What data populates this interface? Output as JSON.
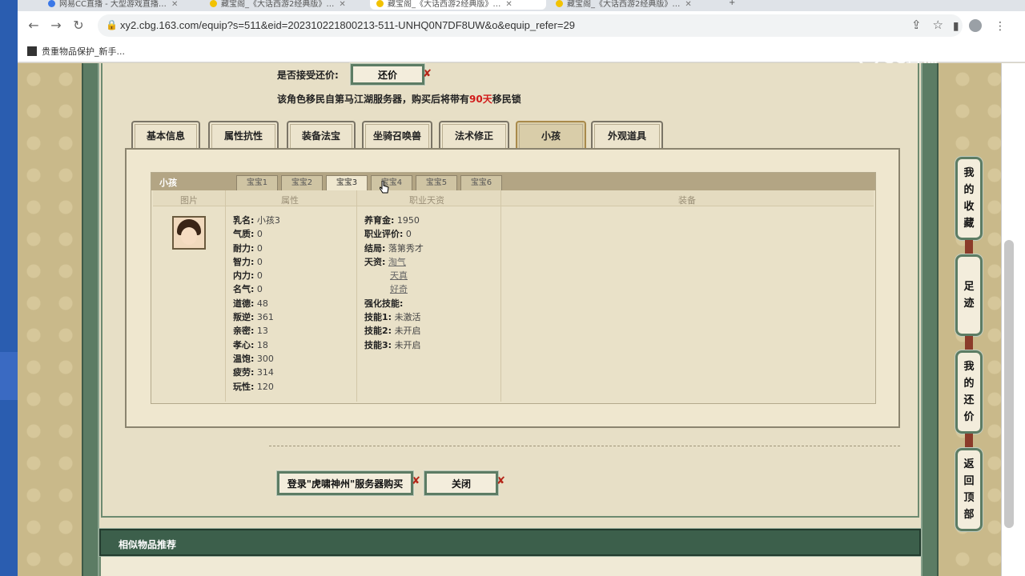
{
  "browser": {
    "tabs": [
      {
        "label": "网易CC直播 - 大型游戏直播…"
      },
      {
        "label": "藏宝阁_《大话西游2经典版》…"
      },
      {
        "label": "藏宝阁_《大话西游2经典版》…"
      },
      {
        "label": "藏宝阁_《大话西游2经典版》…"
      }
    ],
    "new_tab": "+",
    "url": "xy2.cbg.163.com/equip?s=511&eid=202310221800213-511-UNHQ0N7DF8UW&o&equip_refer=29",
    "bookmark": "贵重物品保护_新手..."
  },
  "offer": {
    "question": "是否接受还价:",
    "button": "还价",
    "note_prefix": "该角色移民自第马江湖服务器，购买后将带有",
    "note_days": "90天",
    "note_suffix": "移民锁"
  },
  "category_tabs": [
    "基本信息",
    "属性抗性",
    "装备法宝",
    "坐骑召唤兽",
    "法术修正",
    "小孩",
    "外观道具"
  ],
  "child_panel": {
    "title": "小孩",
    "pet_tabs": [
      "宝宝1",
      "宝宝2",
      "宝宝3",
      "宝宝4",
      "宝宝5",
      "宝宝6"
    ],
    "columns": [
      "图片",
      "属性",
      "职业天资",
      "装备"
    ],
    "attributes": [
      {
        "key": "乳名:",
        "value": "小孩3"
      },
      {
        "key": "气质:",
        "value": "0"
      },
      {
        "key": "耐力:",
        "value": "0"
      },
      {
        "key": "智力:",
        "value": "0"
      },
      {
        "key": "内力:",
        "value": "0"
      },
      {
        "key": "名气:",
        "value": "0"
      },
      {
        "key": "道德:",
        "value": "48"
      },
      {
        "key": "叛逆:",
        "value": "361"
      },
      {
        "key": "亲密:",
        "value": "13"
      },
      {
        "key": "孝心:",
        "value": "18"
      },
      {
        "key": "温饱:",
        "value": "300"
      },
      {
        "key": "疲劳:",
        "value": "314"
      },
      {
        "key": "玩性:",
        "value": "120"
      }
    ],
    "career": {
      "upkeep_key": "养育金:",
      "upkeep_value": "1950",
      "rating_key": "职业评价:",
      "rating_value": "0",
      "ending_key": "结局:",
      "ending_value": "落第秀才",
      "talent_key": "天资:",
      "talents": [
        "淘气",
        "天真",
        "好奇"
      ],
      "skills_key": "强化技能:",
      "skill1_key": "技能1:",
      "skill1_value": "未激活",
      "skill2_key": "技能2:",
      "skill2_value": "未开启",
      "skill3_key": "技能3:",
      "skill3_value": "未开启"
    }
  },
  "actions": {
    "login_buy": "登录\"虎啸神州\"服务器购买",
    "close": "关闭"
  },
  "similar_title": "相似物品推荐",
  "side_buttons": {
    "favorites": [
      "我",
      "的",
      "收",
      "藏"
    ],
    "footprints": [
      "足",
      "迹"
    ],
    "my_offers": [
      "我",
      "的",
      "还",
      "价"
    ],
    "back_top": [
      "返",
      "回",
      "顶",
      "部"
    ]
  },
  "watermark": "CC直播",
  "colors": {
    "accent_red": "#d11a1a",
    "frame_green": "#5c7c64",
    "similar_bar": "#3c5f4b"
  }
}
